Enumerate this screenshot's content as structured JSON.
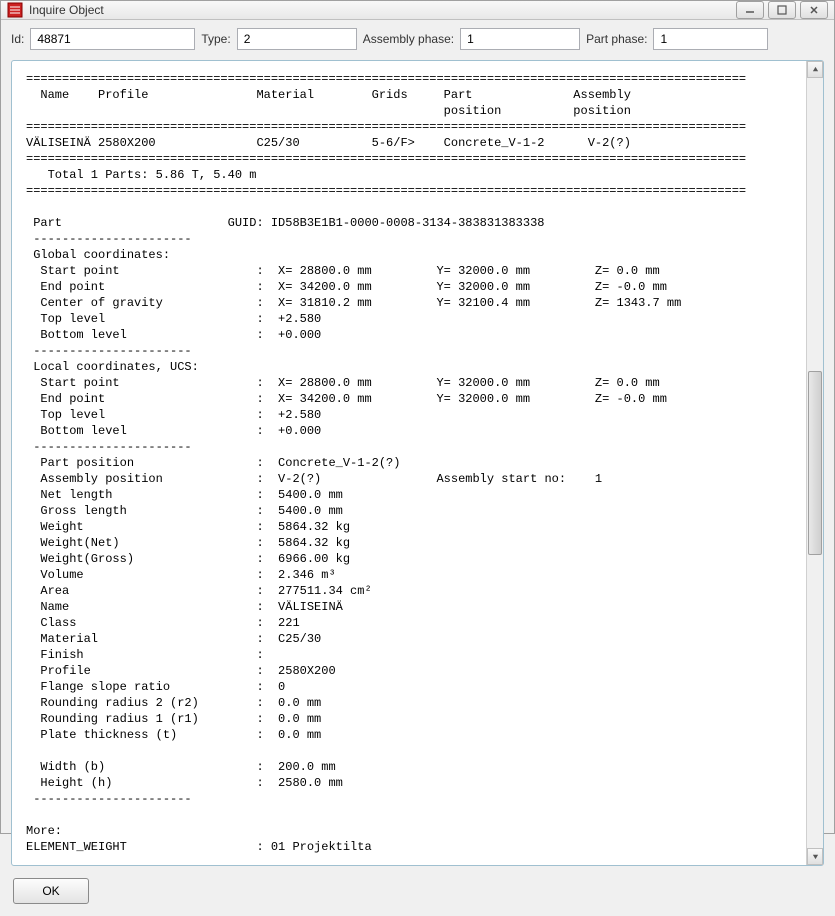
{
  "window": {
    "title": "Inquire Object"
  },
  "fields": {
    "id_label": "Id:",
    "id_value": "48871",
    "type_label": "Type:",
    "type_value": "2",
    "assembly_phase_label": "Assembly phase:",
    "assembly_phase_value": "1",
    "part_phase_label": "Part phase:",
    "part_phase_value": "1"
  },
  "header": {
    "name": "Name",
    "profile": "Profile",
    "material": "Material",
    "grids": "Grids",
    "part_position": "Part\nposition",
    "assembly_position": "Assembly\nposition"
  },
  "row": {
    "name": "VÄLISEINÄ",
    "profile": "2580X200",
    "material": "C25/30",
    "grids": "5-6/F>",
    "part_position": "Concrete_V-1-2",
    "assembly_position": "V-2(?)"
  },
  "summary": "Total 1 Parts: 5.86 T, 5.40 m",
  "part_section": {
    "label": "Part",
    "guid_label": "GUID:",
    "guid_value": "ID58B3E1B1-0000-0008-3134-383831383338"
  },
  "global": {
    "title": "Global coordinates:",
    "rows": [
      {
        "k": "Start point",
        "x": "X= 28800.0 mm",
        "y": "Y= 32000.0 mm",
        "z": "Z= 0.0 mm"
      },
      {
        "k": "End point",
        "x": "X= 34200.0 mm",
        "y": "Y= 32000.0 mm",
        "z": "Z= -0.0 mm"
      },
      {
        "k": "Center of gravity",
        "x": "X= 31810.2 mm",
        "y": "Y= 32100.4 mm",
        "z": "Z= 1343.7 mm"
      },
      {
        "k": "Top level",
        "x": "+2.580",
        "y": "",
        "z": ""
      },
      {
        "k": "Bottom level",
        "x": "+0.000",
        "y": "",
        "z": ""
      }
    ]
  },
  "local": {
    "title": "Local coordinates, UCS:",
    "rows": [
      {
        "k": "Start point",
        "x": "X= 28800.0 mm",
        "y": "Y= 32000.0 mm",
        "z": "Z= 0.0 mm"
      },
      {
        "k": "End point",
        "x": "X= 34200.0 mm",
        "y": "Y= 32000.0 mm",
        "z": "Z= -0.0 mm"
      },
      {
        "k": "Top level",
        "x": "+2.580",
        "y": "",
        "z": ""
      },
      {
        "k": "Bottom level",
        "x": "+0.000",
        "y": "",
        "z": ""
      }
    ]
  },
  "props": [
    {
      "k": "Part position",
      "v": "Concrete_V-1-2(?)",
      "extra": ""
    },
    {
      "k": "Assembly position",
      "v": "V-2(?)",
      "extra": "Assembly start no:    1"
    },
    {
      "k": "Net length",
      "v": "5400.0 mm",
      "extra": ""
    },
    {
      "k": "Gross length",
      "v": "5400.0 mm",
      "extra": ""
    },
    {
      "k": "Weight",
      "v": "5864.32 kg",
      "extra": ""
    },
    {
      "k": "Weight(Net)",
      "v": "5864.32 kg",
      "extra": ""
    },
    {
      "k": "Weight(Gross)",
      "v": "6966.00 kg",
      "extra": ""
    },
    {
      "k": "Volume",
      "v": "2.346 m³",
      "extra": ""
    },
    {
      "k": "Area",
      "v": "277511.34 cm²",
      "extra": ""
    },
    {
      "k": "Name",
      "v": "VÄLISEINÄ",
      "extra": ""
    },
    {
      "k": "Class",
      "v": "221",
      "extra": ""
    },
    {
      "k": "Material",
      "v": "C25/30",
      "extra": ""
    },
    {
      "k": "Finish",
      "v": "",
      "extra": ""
    },
    {
      "k": "Profile",
      "v": "2580X200",
      "extra": ""
    },
    {
      "k": "Flange slope ratio",
      "v": "0",
      "extra": ""
    },
    {
      "k": "Rounding radius 2 (r2)",
      "v": "0.0 mm",
      "extra": ""
    },
    {
      "k": "Rounding radius 1 (r1)",
      "v": "0.0 mm",
      "extra": ""
    },
    {
      "k": "Plate thickness (t)",
      "v": "0.0 mm",
      "extra": ""
    }
  ],
  "dims": [
    {
      "k": "Width (b)",
      "v": "200.0 mm"
    },
    {
      "k": "Height (h)",
      "v": "2580.0 mm"
    }
  ],
  "more": {
    "label": "More:",
    "rows": [
      {
        "k": "ELEMENT_WEIGHT",
        "v": "01 Projektilta"
      }
    ]
  },
  "footer": {
    "ok": "OK"
  },
  "divider_eq": "====================================================================================================",
  "divider_dash": "----------------------"
}
